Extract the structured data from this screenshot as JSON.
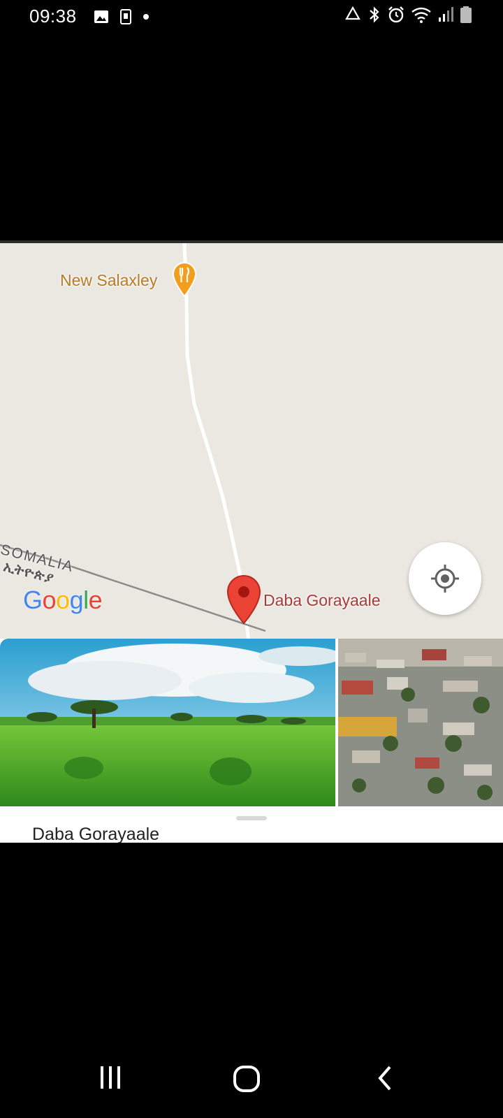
{
  "status_bar": {
    "time": "09:38",
    "left_icons": [
      "image-icon",
      "sim-icon",
      "dot-icon"
    ],
    "right_icons": [
      "recycle-icon",
      "bluetooth-icon",
      "alarm-icon",
      "wifi-icon",
      "signal-icon",
      "battery-icon"
    ]
  },
  "map": {
    "poi": {
      "label": "New Salaxley",
      "icon": "restaurant-pin-icon",
      "color": "#f29e1c"
    },
    "region_labels": {
      "somalia": "SOMALIA",
      "ethiopia": "ኢትዮጵያ"
    },
    "google_logo": {
      "letters": [
        "G",
        "o",
        "o",
        "g",
        "l",
        "e"
      ],
      "colors": [
        "#4285f4",
        "#ea4335",
        "#fbbc05",
        "#4285f4",
        "#34a853",
        "#ea4335"
      ]
    },
    "place": {
      "label": "Daba Gorayaale",
      "icon": "red-pin-icon",
      "color": "#ea4335"
    },
    "locate_button": {
      "icon": "my-location-icon"
    }
  },
  "photos": [
    {
      "name": "savanna-photo"
    },
    {
      "name": "town-aerial-photo"
    }
  ],
  "sheet": {
    "title": "Daba Gorayaale"
  },
  "nav_bar": {
    "buttons": [
      "recent-apps",
      "home",
      "back"
    ]
  }
}
